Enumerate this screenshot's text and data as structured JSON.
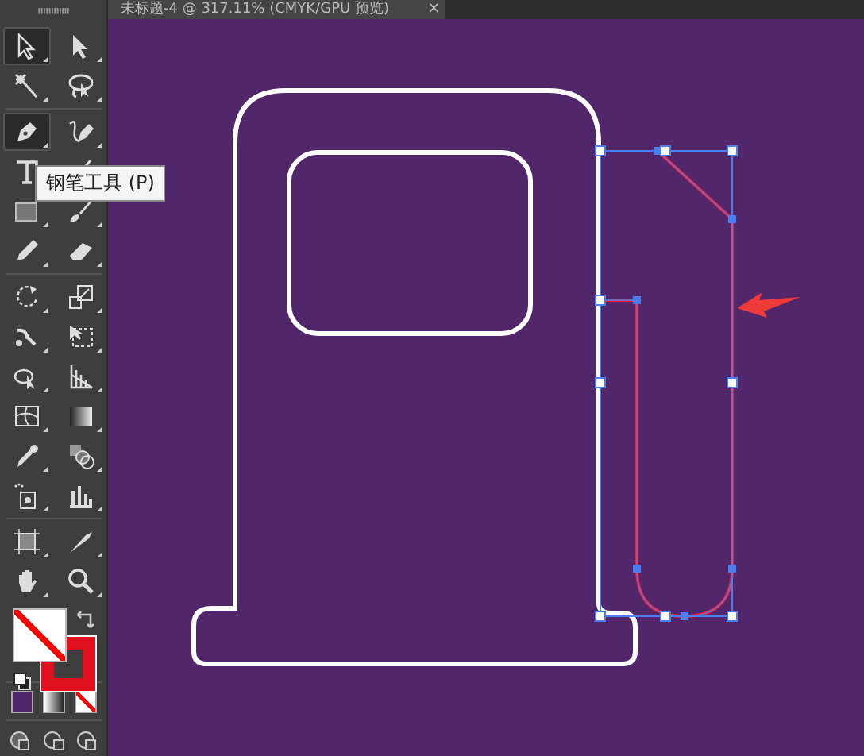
{
  "document_tab": {
    "title": "未标题-4 @ 317.11% (CMYK/GPU 预览)",
    "close": "×"
  },
  "tools": [
    {
      "kind": "selection",
      "selected": true
    },
    {
      "kind": "direct-selection",
      "selected": false
    },
    {
      "kind": "magic-wand",
      "selected": false
    },
    {
      "kind": "lasso",
      "selected": false
    },
    {
      "kind": "pen",
      "selected": true
    },
    {
      "kind": "curvature",
      "selected": false
    },
    {
      "kind": "type",
      "selected": false
    },
    {
      "kind": "line",
      "selected": false
    },
    {
      "kind": "rectangle",
      "selected": false
    },
    {
      "kind": "paintbrush",
      "selected": false
    },
    {
      "kind": "pencil",
      "selected": false
    },
    {
      "kind": "eraser",
      "selected": false
    },
    {
      "kind": "rotate",
      "selected": false
    },
    {
      "kind": "scale",
      "selected": false
    },
    {
      "kind": "puppet-warp",
      "selected": false
    },
    {
      "kind": "free-transform",
      "selected": false
    },
    {
      "kind": "shape-builder",
      "selected": false
    },
    {
      "kind": "perspective-grid",
      "selected": false
    },
    {
      "kind": "mesh",
      "selected": false
    },
    {
      "kind": "gradient",
      "selected": false
    },
    {
      "kind": "eyedropper",
      "selected": false
    },
    {
      "kind": "blend",
      "selected": false
    },
    {
      "kind": "symbol-sprayer",
      "selected": false
    },
    {
      "kind": "column-graph",
      "selected": false
    },
    {
      "kind": "artboard",
      "selected": false
    },
    {
      "kind": "slice",
      "selected": false
    },
    {
      "kind": "hand",
      "selected": false
    },
    {
      "kind": "zoom",
      "selected": false
    }
  ],
  "tooltip": "钢笔工具 (P)"
}
